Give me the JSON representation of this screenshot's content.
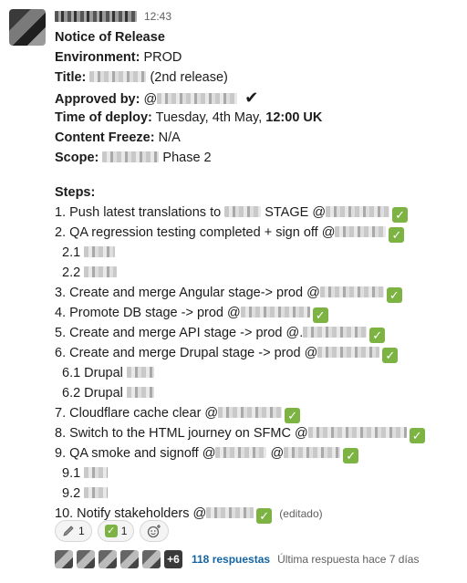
{
  "message": {
    "time": "12:43",
    "title": "Notice of Release",
    "environment_label": "Environment:",
    "environment_value": "PROD",
    "title_label": "Title:",
    "title_value": "(2nd release)",
    "approved_label": "Approved by:",
    "approved_at": "@",
    "approved_mark": "✔",
    "deploy_label": "Time of deploy:",
    "deploy_value": "Tuesday, 4th May,",
    "deploy_time": "12:00 UK",
    "freeze_label": "Content Freeze:",
    "freeze_value": "N/A",
    "scope_label": "Scope:",
    "scope_value": "Phase 2",
    "steps_label": "Steps:",
    "edited": "(editado)"
  },
  "steps": [
    {
      "text": "1. Push latest translations to",
      "suffix": "STAGE @"
    },
    {
      "text": "2. QA regression testing completed + sign off @"
    },
    {
      "text": "2.1"
    },
    {
      "text": "2.2"
    },
    {
      "text": "3. Create and merge Angular stage-> prod @"
    },
    {
      "text": "4. Promote DB stage -> prod @"
    },
    {
      "text": "5. Create and merge API stage -> prod @."
    },
    {
      "text": "6. Create and merge Drupal  stage -> prod @"
    },
    {
      "text": "6.1 Drupal"
    },
    {
      "text": "6.2 Drupal"
    },
    {
      "text": "7. Cloudflare cache clear @"
    },
    {
      "text": "8. Switch to the HTML journey on SFMC @"
    },
    {
      "text": "9. QA smoke and signoff @",
      "suffix": "@"
    },
    {
      "text": "9.1"
    },
    {
      "text": "9.2"
    },
    {
      "text": "10. Notify stakeholders @"
    }
  ],
  "check_glyph": "✓",
  "reactions": [
    {
      "icon": "pen-icon",
      "count": "1"
    },
    {
      "icon": "white-check-mark-icon",
      "count": "1"
    }
  ],
  "thread": {
    "more": "+6",
    "replies": "118 respuestas",
    "last_reply": "Última respuesta hace 7 días"
  }
}
